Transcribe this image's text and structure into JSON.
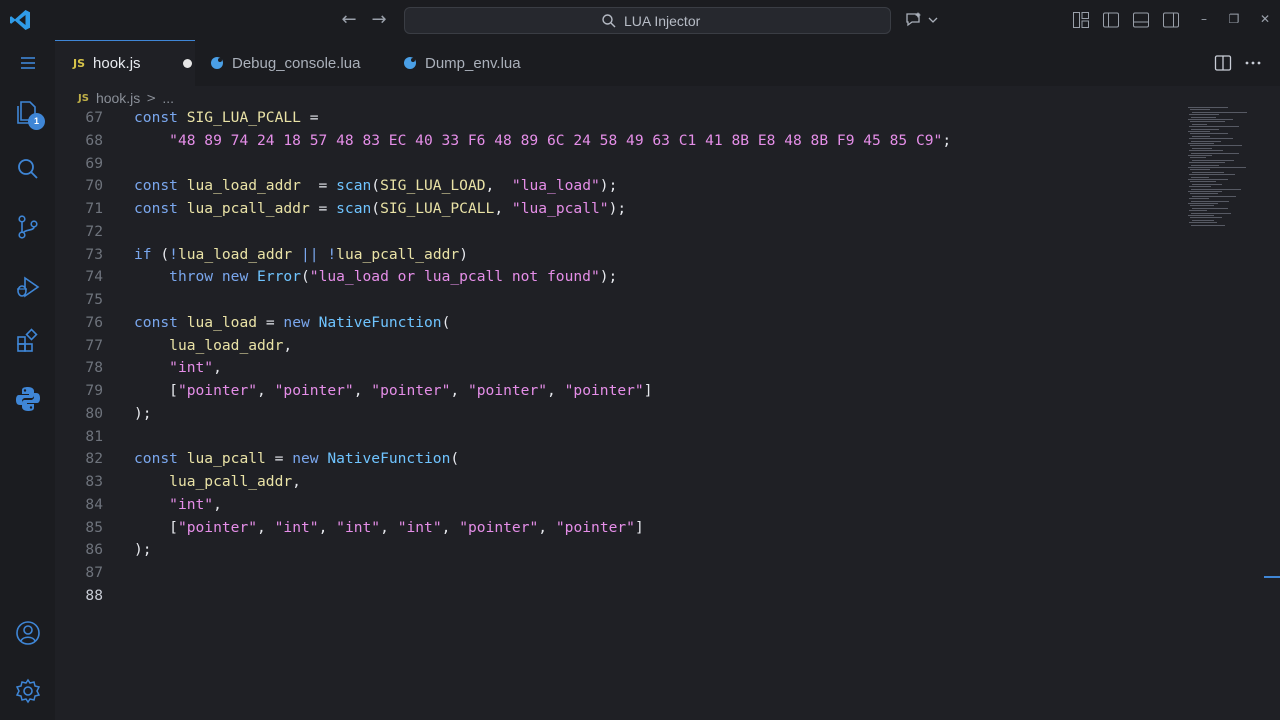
{
  "window": {
    "search_label": "LUA Injector"
  },
  "activity_bar": {
    "source_control_badge": "1",
    "items": [
      "explorer-icon",
      "search-icon",
      "source-control-icon",
      "run-debug-icon",
      "extensions-icon",
      "python-icon"
    ],
    "bottom_items": [
      "account-icon",
      "settings-icon"
    ]
  },
  "tabs": [
    {
      "label": "hook.js",
      "icon": "JS",
      "active": true,
      "dirty": true
    },
    {
      "label": "Debug_console.lua",
      "icon": "lua-icon",
      "active": false
    },
    {
      "label": "Dump_env.lua",
      "icon": "lua-icon",
      "active": false
    }
  ],
  "breadcrumb": {
    "file_icon": "JS",
    "file": "hook.js",
    "separator": ">",
    "more": "..."
  },
  "editor": {
    "current_line": 88,
    "lines": [
      {
        "n": "67",
        "code": "const SIG_LUA_PCALL ="
      },
      {
        "n": "68",
        "code": "    \"48 89 74 24 18 57 48 83 EC 40 33 F6 48 89 6C 24 58 49 63 C1 41 8B E8 48 8B F9 45 85 C9\";"
      },
      {
        "n": "69",
        "code": ""
      },
      {
        "n": "70",
        "code": "const lua_load_addr  = scan(SIG_LUA_LOAD,  \"lua_load\");"
      },
      {
        "n": "71",
        "code": "const lua_pcall_addr = scan(SIG_LUA_PCALL, \"lua_pcall\");"
      },
      {
        "n": "72",
        "code": ""
      },
      {
        "n": "73",
        "code": "if (!lua_load_addr || !lua_pcall_addr)"
      },
      {
        "n": "74",
        "code": "    throw new Error(\"lua_load or lua_pcall not found\");"
      },
      {
        "n": "75",
        "code": ""
      },
      {
        "n": "76",
        "code": "const lua_load = new NativeFunction("
      },
      {
        "n": "77",
        "code": "    lua_load_addr,"
      },
      {
        "n": "78",
        "code": "    \"int\","
      },
      {
        "n": "79",
        "code": "    [\"pointer\", \"pointer\", \"pointer\", \"pointer\", \"pointer\"]"
      },
      {
        "n": "80",
        "code": ");"
      },
      {
        "n": "81",
        "code": ""
      },
      {
        "n": "82",
        "code": "const lua_pcall = new NativeFunction("
      },
      {
        "n": "83",
        "code": "    lua_pcall_addr,"
      },
      {
        "n": "84",
        "code": "    \"int\","
      },
      {
        "n": "85",
        "code": "    [\"pointer\", \"int\", \"int\", \"int\", \"pointer\", \"pointer\"]"
      },
      {
        "n": "86",
        "code": ");"
      },
      {
        "n": "87",
        "code": ""
      },
      {
        "n": "88",
        "code": ""
      }
    ]
  },
  "colors": {
    "accent": "#3f86d6",
    "keyword": "#7aa7ee",
    "variable": "#e9e2a6",
    "function": "#6fc4ff",
    "string": "#e58ee8",
    "background": "#1f2025"
  }
}
